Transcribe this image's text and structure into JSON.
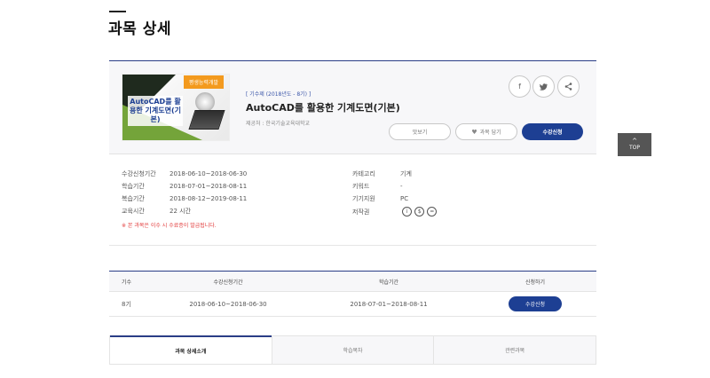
{
  "page": {
    "title": "과목 상세"
  },
  "course": {
    "thumbnail": {
      "badge": "평생능력개발",
      "text": "AutoCAD를 활용한 기계도면(기본)"
    },
    "period_label": "[ 기수제 (2018년도 - 8기) ]",
    "name": "AutoCAD를 활용한 기계도면(기본)",
    "provider": "제공처 : 한국기술교육대학교",
    "social": [
      {
        "icon": "facebook-icon",
        "glyph": "f"
      },
      {
        "icon": "twitter-icon",
        "glyph": "t"
      },
      {
        "icon": "share-icon",
        "glyph": "<"
      }
    ],
    "buttons": {
      "preview": "맛보기",
      "favorite": "과목 담기",
      "enroll": "수강신청"
    }
  },
  "info": {
    "left": [
      {
        "label": "수강신청기간",
        "value": "2018-06-10~2018-06-30"
      },
      {
        "label": "학습기간",
        "value": "2018-07-01~2018-08-11"
      },
      {
        "label": "복습기간",
        "value": "2018-08-12~2019-08-11"
      },
      {
        "label": "교육시간",
        "value": "22 시간"
      }
    ],
    "right": [
      {
        "label": "카테고리",
        "value": "기계"
      },
      {
        "label": "키워드",
        "value": "-"
      },
      {
        "label": "기기지원",
        "value": "PC"
      },
      {
        "label": "저작권",
        "value": ""
      }
    ],
    "license_icons": [
      "i",
      "$",
      "="
    ],
    "notice": "※ 본 과목은 이수 시 수료증이 발급됩니다."
  },
  "schedule": {
    "headers": [
      "기수",
      "수강신청기간",
      "학습기간",
      "신청하기"
    ],
    "rows": [
      {
        "term": "8기",
        "apply": "2018-06-10~2018-06-30",
        "study": "2018-07-01~2018-08-11",
        "action": "수강신청"
      }
    ]
  },
  "tabs": [
    "과목 상세소개",
    "학습목차",
    "관련과목"
  ],
  "top_button": {
    "arrow": "^",
    "label": "TOP"
  },
  "colors": {
    "accent": "#1d3f93",
    "notice": "#e23b3b",
    "badge": "#f39a1e"
  }
}
